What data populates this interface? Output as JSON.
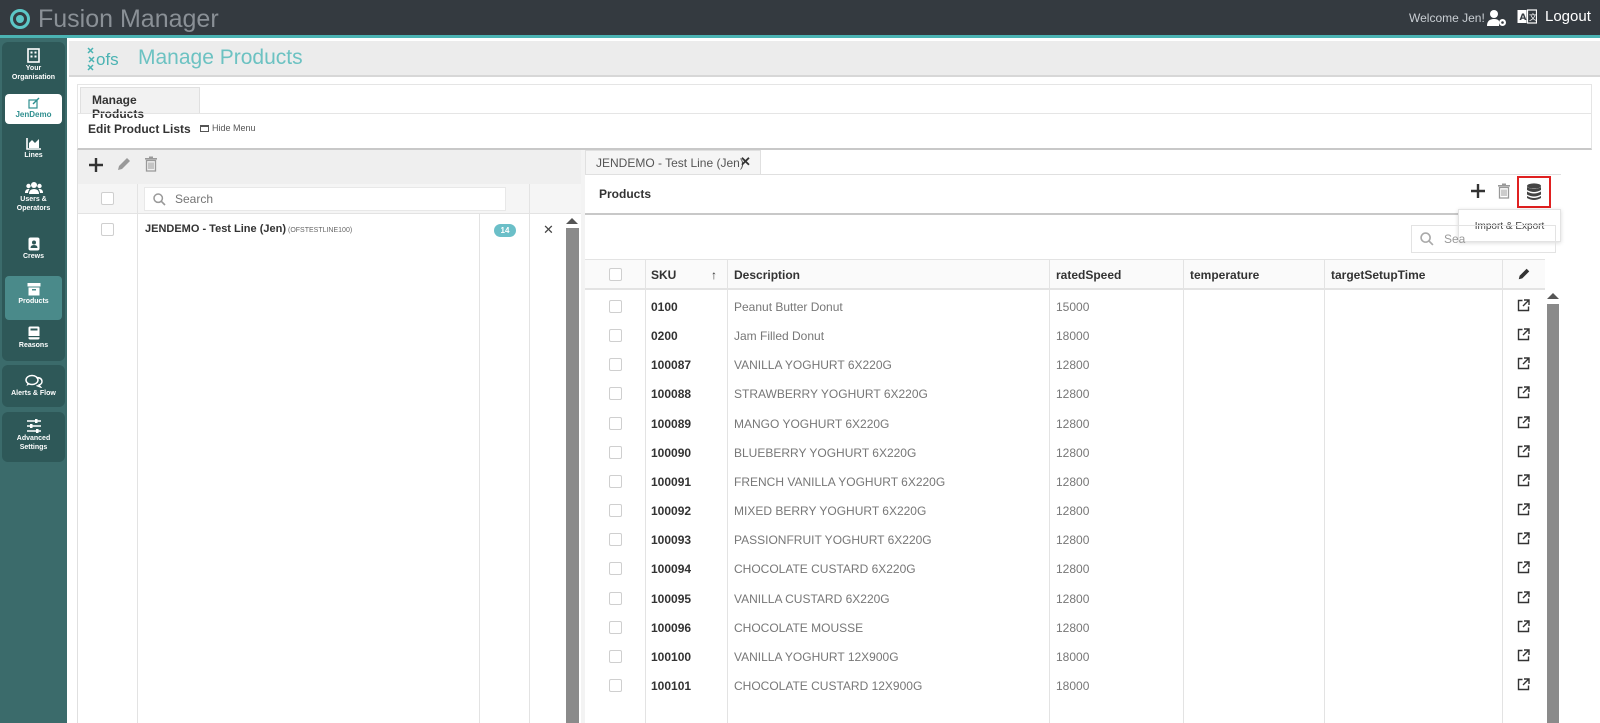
{
  "app": {
    "title": "Fusion Manager",
    "welcome": "Welcome Jen!",
    "logout": "Logout"
  },
  "sidebar": {
    "items": [
      {
        "label1": "Your",
        "label2": "Organisation",
        "icon": "building-icon"
      },
      {
        "label1": "JenDemo",
        "label2": "",
        "icon": "edit-icon"
      },
      {
        "label1": "Lines",
        "label2": "",
        "icon": "chart-icon"
      },
      {
        "label1": "Users &",
        "label2": "Operators",
        "icon": "users-icon"
      },
      {
        "label1": "Crews",
        "label2": "",
        "icon": "id-badge-icon"
      },
      {
        "label1": "Products",
        "label2": "",
        "icon": "box-icon"
      },
      {
        "label1": "Reasons",
        "label2": "",
        "icon": "book-icon"
      },
      {
        "label1": "Alerts & Flow",
        "label2": "",
        "icon": "chat-icon"
      },
      {
        "label1": "Advanced",
        "label2": "Settings",
        "icon": "sliders-icon"
      }
    ]
  },
  "header": {
    "logo": "ofs",
    "title": "Manage Products"
  },
  "tabs": {
    "manage": "Manage Products"
  },
  "edit_lists": {
    "title": "Edit Product Lists",
    "hide_menu": "Hide Menu"
  },
  "left": {
    "search_placeholder": "Search",
    "line": {
      "name": "JENDEMO - Test Line (Jen)",
      "code": "(OFSTESTLINE100)",
      "count": "14"
    }
  },
  "right": {
    "tab": "JENDEMO - Test Line (Jen)",
    "section_title": "Products",
    "tooltip": "Import & Export",
    "search_placeholder": "Sea",
    "columns": [
      "SKU",
      "Description",
      "ratedSpeed",
      "temperature",
      "targetSetupTime"
    ],
    "sort_indicator": "↑",
    "rows": [
      {
        "sku": "0100",
        "description": "Peanut Butter Donut",
        "ratedSpeed": "15000"
      },
      {
        "sku": "0200",
        "description": "Jam Filled Donut",
        "ratedSpeed": "18000"
      },
      {
        "sku": "100087",
        "description": "VANILLA YOGHURT 6X220G",
        "ratedSpeed": "12800"
      },
      {
        "sku": "100088",
        "description": "STRAWBERRY YOGHURT 6X220G",
        "ratedSpeed": "12800"
      },
      {
        "sku": "100089",
        "description": "MANGO YOGHURT 6X220G",
        "ratedSpeed": "12800"
      },
      {
        "sku": "100090",
        "description": "BLUEBERRY YOGHURT 6X220G",
        "ratedSpeed": "12800"
      },
      {
        "sku": "100091",
        "description": "FRENCH VANILLA YOGHURT 6X220G",
        "ratedSpeed": "12800"
      },
      {
        "sku": "100092",
        "description": "MIXED BERRY YOGHURT 6X220G",
        "ratedSpeed": "12800"
      },
      {
        "sku": "100093",
        "description": "PASSIONFRUIT YOGHURT 6X220G",
        "ratedSpeed": "12800"
      },
      {
        "sku": "100094",
        "description": "CHOCOLATE CUSTARD 6X220G",
        "ratedSpeed": "12800"
      },
      {
        "sku": "100095",
        "description": "VANILLA CUSTARD 6X220G",
        "ratedSpeed": "12800"
      },
      {
        "sku": "100096",
        "description": "CHOCOLATE MOUSSE",
        "ratedSpeed": "12800"
      },
      {
        "sku": "100100",
        "description": "VANILLA YOGHURT 12X900G",
        "ratedSpeed": "18000"
      },
      {
        "sku": "100101",
        "description": "CHOCOLATE CUSTARD 12X900G",
        "ratedSpeed": "18000"
      }
    ]
  },
  "colors": {
    "accent": "#4bb3b3",
    "topbar": "#343a40",
    "sidebar": "#3b6b6b",
    "highlight": "#e02020"
  }
}
